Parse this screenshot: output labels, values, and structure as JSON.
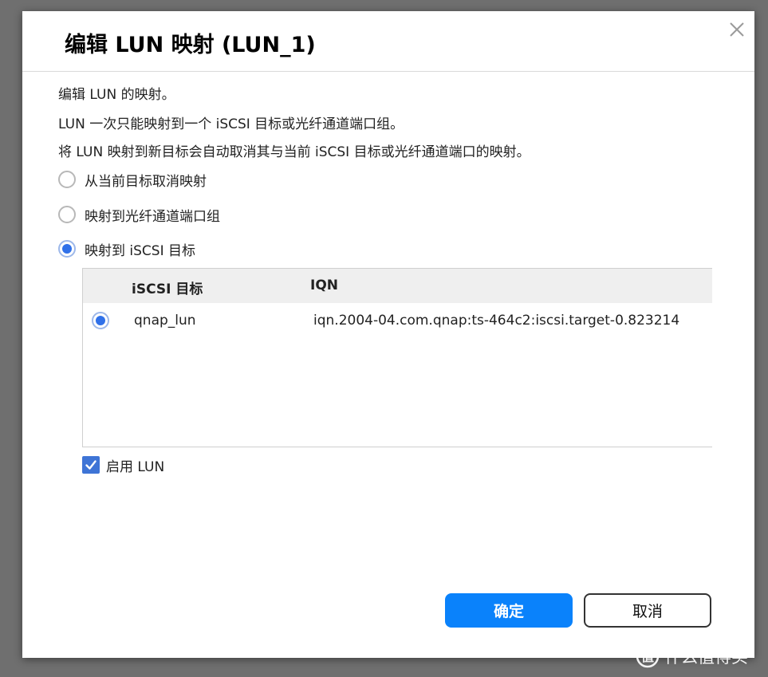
{
  "dialog": {
    "title": "编辑 LUN 映射 (LUN_1)",
    "descriptions": [
      "编辑 LUN 的映射。",
      "LUN 一次只能映射到一个 iSCSI 目标或光纤通道端口组。",
      "将 LUN 映射到新目标会自动取消其与当前 iSCSI 目标或光纤通道端口的映射。"
    ],
    "options": [
      {
        "label": "从当前目标取消映射",
        "selected": false
      },
      {
        "label": "映射到光纤通道端口组",
        "selected": false
      },
      {
        "label": "映射到 iSCSI 目标",
        "selected": true
      }
    ],
    "table": {
      "headers": [
        "iSCSI 目标",
        "IQN"
      ],
      "rows": [
        {
          "selected": true,
          "target": "qnap_lun",
          "iqn": "iqn.2004-04.com.qnap:ts-464c2:iscsi.target-0.823214"
        }
      ]
    },
    "enable_lun": {
      "label": "启用 LUN",
      "checked": true
    },
    "buttons": {
      "ok": "确定",
      "cancel": "取消"
    }
  },
  "watermark": {
    "text": "什么值得买"
  },
  "colors": {
    "primary": "#0a82fb",
    "radio_checked": "#3071e9",
    "checkbox": "#3e74d6"
  }
}
